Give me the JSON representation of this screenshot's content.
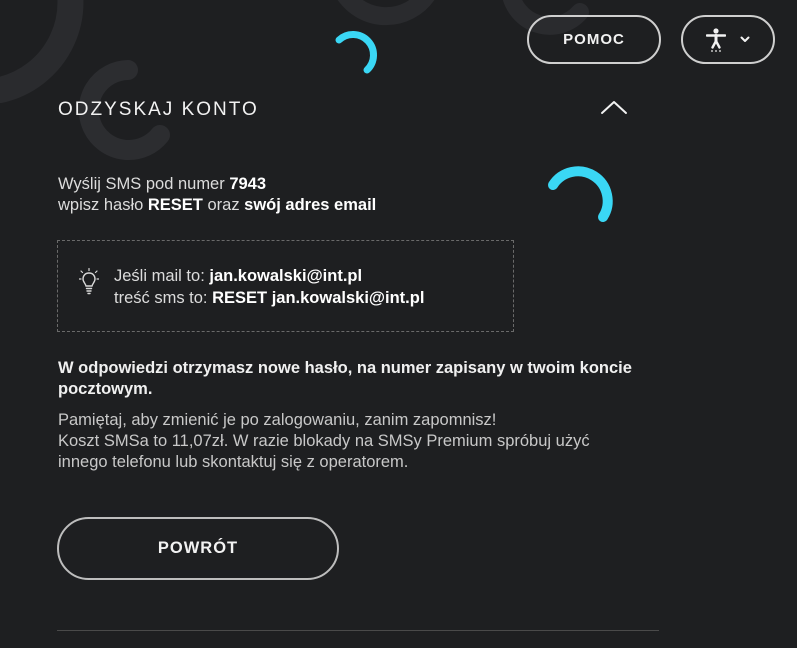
{
  "header": {
    "help_label": "POMOC",
    "accessibility_icon": "accessibility-icon",
    "dropdown_icon": "chevron-down-icon"
  },
  "panel": {
    "title": "ODZYSKAJ KONTO",
    "collapse_icon": "chevron-up-icon"
  },
  "instructions": {
    "line1_prefix": "Wyślij SMS pod numer ",
    "sms_number": "7943",
    "line2_prefix": "wpisz hasło ",
    "keyword": "RESET",
    "line2_middle": " oraz ",
    "line2_suffix": "swój adres email"
  },
  "example": {
    "icon": "lightbulb-icon",
    "mail_label": "Jeśli mail to: ",
    "mail_value": "jan.kowalski@int.pl",
    "sms_label": "treść sms to: ",
    "sms_value": "RESET jan.kowalski@int.pl"
  },
  "bold_note": "W odpowiedzi otrzymasz nowe hasło, na numer zapisany w twoim koncie pocztowym.",
  "note_lines": [
    "Pamiętaj, aby zmienić je po zalogowaniu, zanim zapomnisz!",
    "Koszt SMSa to 11,07zł. W razie blokady na SMSy Premium spróbuj użyć",
    "innego telefonu lub skontaktuj się z operatorem."
  ],
  "back_label": "POWRÓT",
  "colors": {
    "background": "#1e1f21",
    "accent": "#3ad7f5",
    "decor": "#2b2c2f"
  }
}
